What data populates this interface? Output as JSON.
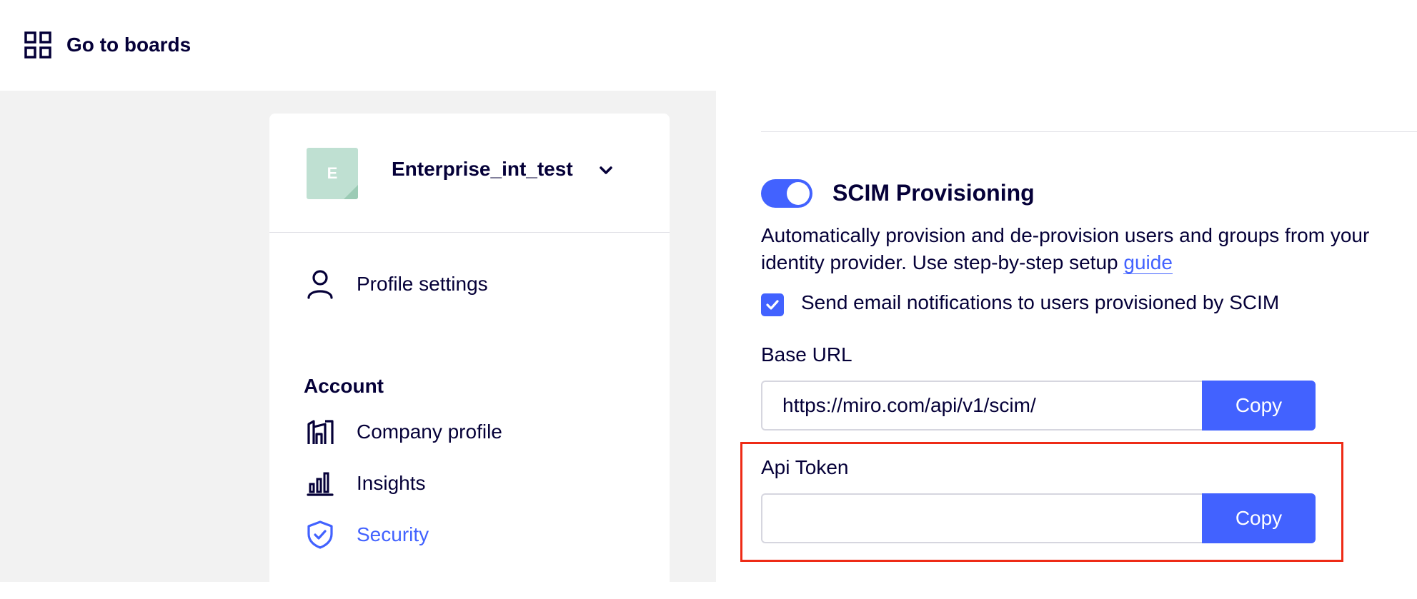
{
  "topbar": {
    "go_to_boards_label": "Go to boards",
    "icon": "grid-icon"
  },
  "workspace": {
    "avatar_letter": "E",
    "name": "Enterprise_int_test",
    "avatar_color": "#bfe0d2"
  },
  "nav": {
    "profile_settings": "Profile settings",
    "account_heading": "Account",
    "items": [
      {
        "label": "Company profile",
        "icon": "building-icon",
        "active": false
      },
      {
        "label": "Insights",
        "icon": "bar-chart-icon",
        "active": false
      },
      {
        "label": "Security",
        "icon": "shield-check-icon",
        "active": true
      }
    ]
  },
  "scim": {
    "enabled": true,
    "title": "SCIM Provisioning",
    "description_line1": "Automatically provision and de-provision users and groups from your",
    "description_line2_prefix": "identity provider. Use step-by-step setup ",
    "guide_link": "guide",
    "notify_checked": true,
    "notify_label": "Send email notifications to users provisioned by SCIM",
    "base_url_label": "Base URL",
    "base_url_value": "https://miro.com/api/v1/scim/",
    "api_token_label": "Api Token",
    "api_token_value": "",
    "copy_label": "Copy"
  },
  "colors": {
    "accent": "#4262ff",
    "text": "#050038",
    "highlight": "#ee2b16",
    "sidebar_bg": "#f2f2f2"
  }
}
